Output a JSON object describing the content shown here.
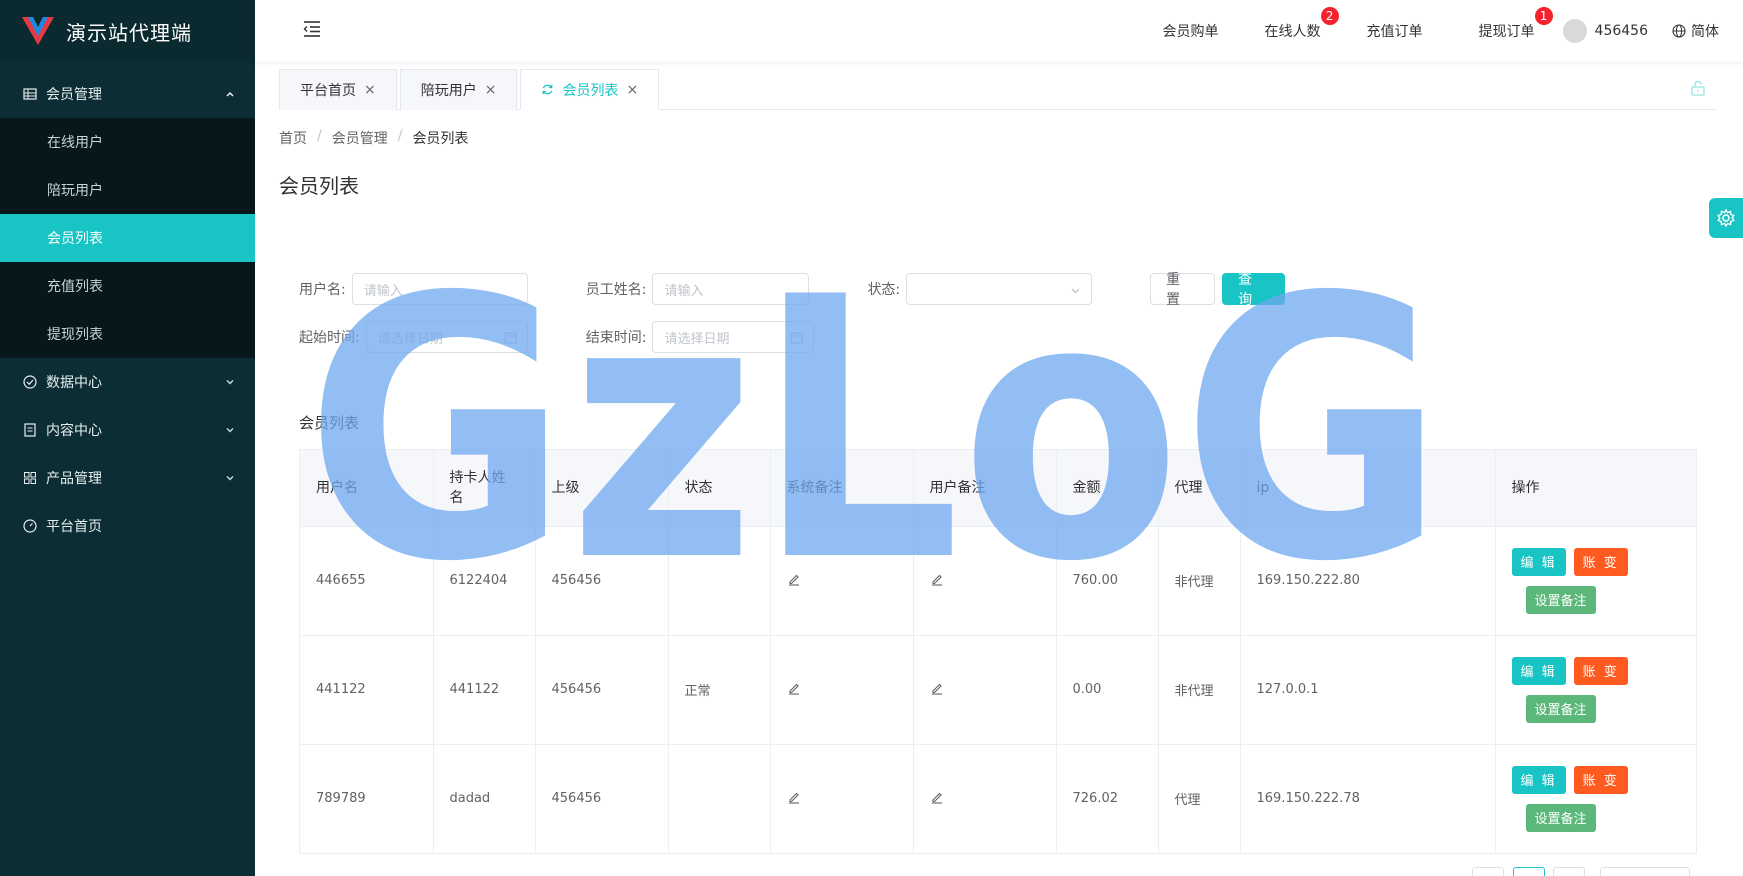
{
  "app": {
    "title": "演示站代理端"
  },
  "sidebar": {
    "groups": [
      {
        "label": "会员管理",
        "icon": "grid-icon",
        "expanded": true,
        "items": [
          {
            "label": "在线用户"
          },
          {
            "label": "陪玩用户"
          },
          {
            "label": "会员列表",
            "active": true
          },
          {
            "label": "充值列表"
          },
          {
            "label": "提现列表"
          }
        ]
      },
      {
        "label": "数据中心",
        "icon": "check-circle-icon"
      },
      {
        "label": "内容中心",
        "icon": "document-icon"
      },
      {
        "label": "产品管理",
        "icon": "apps-icon"
      },
      {
        "label": "平台首页",
        "icon": "dashboard-icon"
      }
    ]
  },
  "header": {
    "links": [
      {
        "label": "会员购单"
      },
      {
        "label": "在线人数",
        "badge": "2"
      },
      {
        "label": "充值订单"
      },
      {
        "label": "提现订单",
        "badge": "1"
      }
    ],
    "username": "456456",
    "language": "简体"
  },
  "tabs": [
    {
      "label": "平台首页"
    },
    {
      "label": "陪玩用户"
    },
    {
      "label": "会员列表",
      "active": true
    }
  ],
  "breadcrumb": [
    "首页",
    "会员管理",
    "会员列表"
  ],
  "page_title": "会员列表",
  "filters": {
    "username_label": "用户名:",
    "username_placeholder": "请输入",
    "staff_label": "员工姓名:",
    "staff_placeholder": "请输入",
    "status_label": "状态:",
    "status_value": "",
    "reset_label": "重 置",
    "query_label": "查 询",
    "start_label": "起始时间:",
    "start_placeholder": "请选择日期",
    "end_label": "结束时间:",
    "end_placeholder": "请选择日期"
  },
  "table": {
    "title": "会员列表",
    "columns": [
      "用户名",
      "持卡人姓名",
      "上级",
      "状态",
      "系统备注",
      "用户备注",
      "金额",
      "代理",
      "ip",
      "操作"
    ],
    "rows": [
      {
        "username": "446655",
        "cardholder": "6122404",
        "parent": "456456",
        "status": "",
        "amount": "760.00",
        "agent": "非代理",
        "ip": "169.150.222.80"
      },
      {
        "username": "441122",
        "cardholder": "441122",
        "parent": "456456",
        "status": "正常",
        "amount": "0.00",
        "agent": "非代理",
        "ip": "127.0.0.1"
      },
      {
        "username": "789789",
        "cardholder": "dadad",
        "parent": "456456",
        "status": "",
        "amount": "726.02",
        "agent": "代理",
        "ip": "169.150.222.78"
      }
    ],
    "actions": {
      "edit": "编 辑",
      "account": "账 变",
      "note": "设置备注"
    }
  },
  "watermark": "GzLoG",
  "colors": {
    "sidebar_bg": "#0c2d33",
    "accent": "#18c4c4",
    "danger": "#ff5a1f",
    "success": "#5cb87a",
    "watermark": "#6fa8f0"
  }
}
